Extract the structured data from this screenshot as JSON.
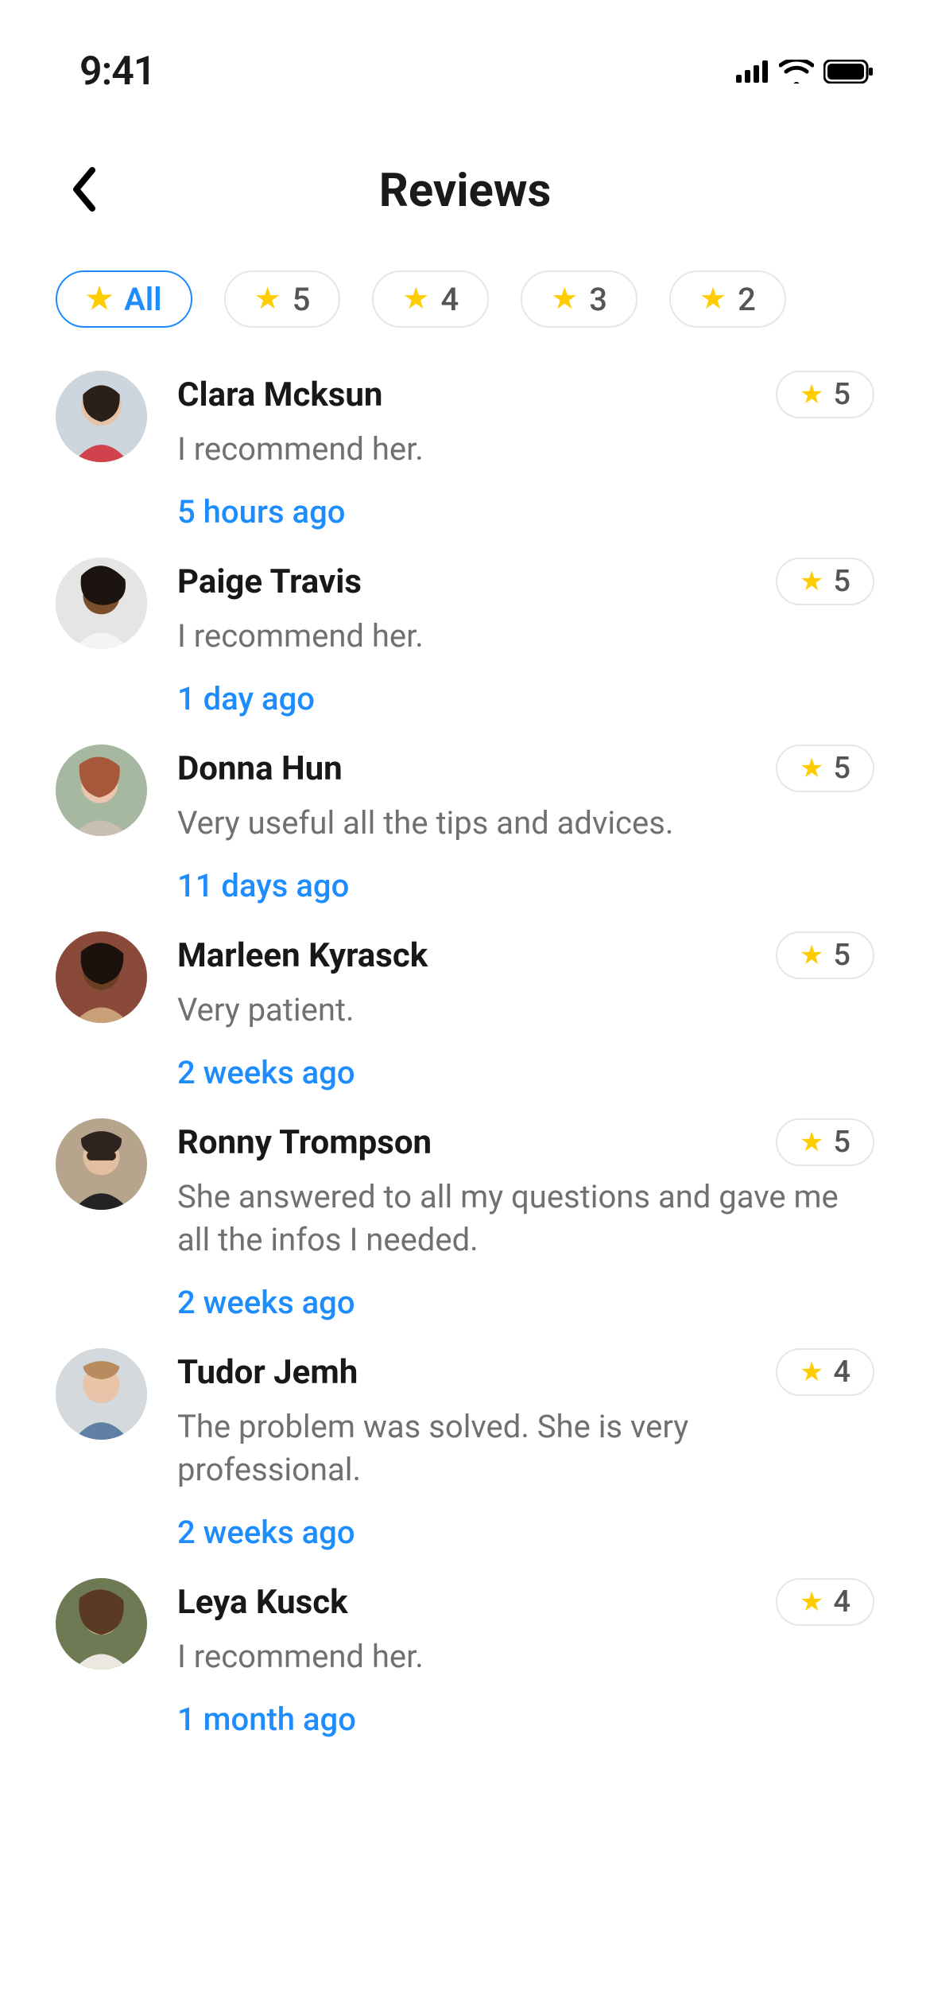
{
  "status": {
    "time": "9:41"
  },
  "header": {
    "title": "Reviews"
  },
  "filters": [
    {
      "label": "All",
      "active": true
    },
    {
      "label": "5",
      "active": false
    },
    {
      "label": "4",
      "active": false
    },
    {
      "label": "3",
      "active": false
    },
    {
      "label": "2",
      "active": false
    }
  ],
  "colors": {
    "accent": "#1c8cff",
    "star": "#ffcc00",
    "muted": "#6e7074",
    "border": "#e4e6ea"
  },
  "reviews": [
    {
      "name": "Clara Mcksun",
      "text": "I recommend her.",
      "rating": "5",
      "time": "5 hours ago"
    },
    {
      "name": "Paige Travis",
      "text": "I recommend her.",
      "rating": "5",
      "time": "1 day ago"
    },
    {
      "name": "Donna Hun",
      "text": "Very useful all the tips and advices.",
      "rating": "5",
      "time": "11 days ago"
    },
    {
      "name": "Marleen Kyrasck",
      "text": "Very patient.",
      "rating": "5",
      "time": "2 weeks ago"
    },
    {
      "name": "Ronny Trompson",
      "text": "She answered to all my questions and gave me all the infos I needed.",
      "rating": "5",
      "time": "2 weeks ago"
    },
    {
      "name": "Tudor Jemh",
      "text": "The problem was solved. She is very professional.",
      "rating": "4",
      "time": "2 weeks ago"
    },
    {
      "name": "Leya Kusck",
      "text": "I recommend her.",
      "rating": "4",
      "time": "1 month ago"
    }
  ]
}
